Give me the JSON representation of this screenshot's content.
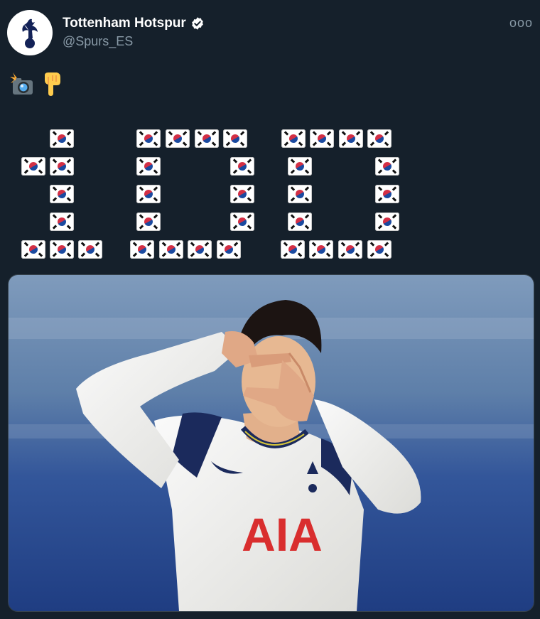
{
  "account": {
    "display_name": "Tottenham Hotspur",
    "handle": "@Spurs_ES",
    "verified": true,
    "avatar_icon": "spurs-cockerel-logo"
  },
  "menu": {
    "more_label": "ooo"
  },
  "tweet": {
    "emoji_line": [
      "camera-with-flash-emoji",
      "backhand-index-pointing-down-emoji"
    ],
    "flag_art": {
      "emoji": "south-korea-flag",
      "pattern_reads": "100"
    }
  },
  "media": {
    "alt": "",
    "jersey_sponsor": "AIA",
    "colors": {
      "background_top": "#6f8fb3",
      "background_bottom": "#24448c",
      "jersey": "#f3f4f2",
      "sponsor": "#d92e2e"
    }
  },
  "theme": {
    "background": "#15202b",
    "secondary_text": "#8899a6",
    "border": "#38444d"
  }
}
